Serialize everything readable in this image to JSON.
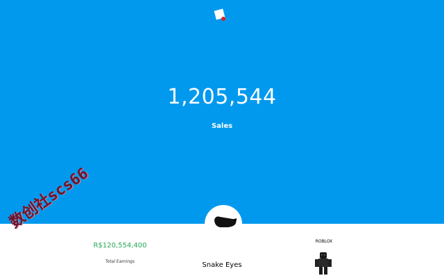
{
  "sales": {
    "count": "1,205,544",
    "label": "Sales"
  },
  "earnings": {
    "value": "R$120,554,400",
    "label": "Total Earnings"
  },
  "item": {
    "name": "Snake Eyes",
    "icon": "black-headband-icon"
  },
  "creator": {
    "name": "ROBLOX",
    "avatar_icon": "roblox-avatar-icon"
  },
  "watermark": {
    "text": "数创社scs66"
  },
  "colors": {
    "hero_background": "#0099ee",
    "earnings_text": "#27a85a",
    "logo_dot": "#e02020"
  }
}
